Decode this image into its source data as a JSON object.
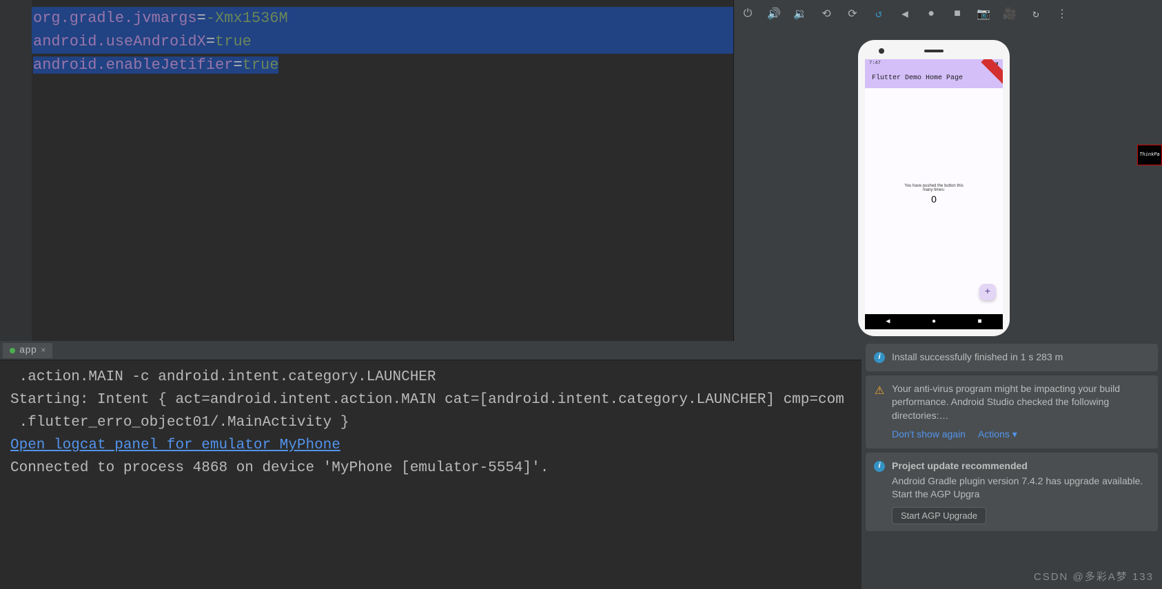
{
  "editor": {
    "lines": [
      {
        "key": "org.gradle.jvmargs",
        "val": "-Xmx1536M"
      },
      {
        "key": "android.useAndroidX",
        "val": "true"
      },
      {
        "key": "android.enableJetifier",
        "val": "true"
      }
    ]
  },
  "emulator": {
    "time": "7:47",
    "app_title": "Flutter Demo Home Page",
    "body_text": "You have pushed the button this many times:",
    "counter": "0",
    "fab_label": "+"
  },
  "console": {
    "tab_label": "app",
    "lines": {
      "l1": " .action.MAIN -c android.intent.category.LAUNCHER",
      "l2": "",
      "l3": "Starting: Intent { act=android.intent.action.MAIN cat=[android.intent.category.LAUNCHER] cmp=com",
      "l4": " .flutter_erro_object01/.MainActivity }",
      "l5": "",
      "l6": "Open logcat panel for emulator MyPhone",
      "l7": "Connected to process 4868 on device 'MyPhone [emulator-5554]'."
    }
  },
  "notifications": {
    "n1": {
      "text": "Install successfully finished in 1 s 283 m"
    },
    "n2": {
      "text": "Your anti-virus program might be impacting your build performance. Android Studio checked the following directories:…",
      "action1": "Don't show again",
      "action2": "Actions ▾"
    },
    "n3": {
      "title": "Project update recommended",
      "text": "Android Gradle plugin version 7.4.2 has upgrade available. Start the AGP Upgra",
      "button": "Start AGP Upgrade"
    }
  },
  "watermark": "CSDN @多彩A梦 133",
  "thinkpad": "ThinkPa"
}
